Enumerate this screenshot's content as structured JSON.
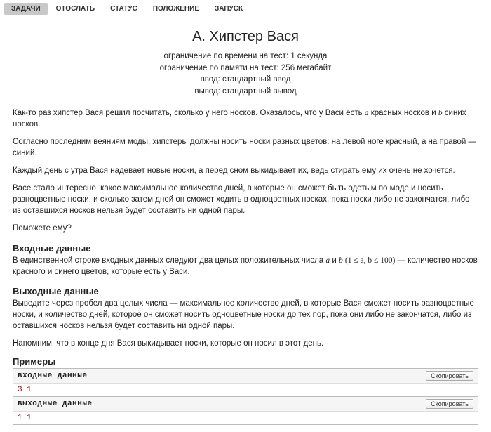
{
  "tabs": {
    "items": [
      {
        "label": "ЗАДАЧИ",
        "active": true
      },
      {
        "label": "ОТОСЛАТЬ",
        "active": false
      },
      {
        "label": "СТАТУС",
        "active": false
      },
      {
        "label": "ПОЛОЖЕНИЕ",
        "active": false
      },
      {
        "label": "ЗАПУСК",
        "active": false
      }
    ]
  },
  "problem": {
    "title": "A. Хипстер Вася",
    "meta": {
      "time_limit": "ограничение по времени на тест: 1 секунда",
      "memory_limit": "ограничение по памяти на тест: 256 мегабайт",
      "input": "ввод: стандартный ввод",
      "output": "вывод: стандартный вывод"
    },
    "statement": {
      "p1_pre": "Как-то раз хипстер Вася решил посчитать, сколько у него носков. Оказалось, что у Васи есть ",
      "p1_var1": "a",
      "p1_mid": " красных носков и ",
      "p1_var2": "b",
      "p1_post": " синих носков.",
      "p2": "Согласно последним веяниям моды, хипстеры должны носить носки разных цветов: на левой ноге красный, а на правой — синий.",
      "p3": "Каждый день с утра Вася надевает новые носки, а перед сном выкидывает их, ведь стирать ему их очень не хочется.",
      "p4": "Васе стало интересно, какое максимальное количество дней, в которые он сможет быть одетым по моде и носить разноцветные носки, и сколько затем дней он сможет ходить в одноцветных носках, пока носки либо не закончатся, либо из оставшихся носков нельзя будет составить ни одной пары.",
      "p5": "Поможете ему?"
    },
    "input_section": {
      "heading": "Входные данные",
      "text_pre": "В единственной строке входных данных следуют два целых положительных числа ",
      "text_var1": "a",
      "text_and": " и ",
      "text_var2": "b",
      "text_space": " ",
      "text_constraint": "(1 ≤ a, b ≤ 100)",
      "text_post": " — количество носков красного и синего цветов, которые есть у Васи."
    },
    "output_section": {
      "heading": "Выходные данные",
      "p1": "Выведите через пробел два целых числа — максимальное количество дней, в которые Вася сможет носить разноцветные носки, и количество дней, которое он сможет носить одноцветные носки до тех пор, пока они либо не закончатся, либо из оставшихся носков нельзя будет составить ни одной пары.",
      "p2": "Напомним, что в конце дня Вася выкидывает носки, которые он носил в этот день."
    },
    "examples": {
      "heading": "Примеры",
      "input_label": "входные данные",
      "output_label": "выходные данные",
      "copy_label": "Скопировать",
      "input_data": "3 1",
      "output_data": "1 1"
    }
  }
}
